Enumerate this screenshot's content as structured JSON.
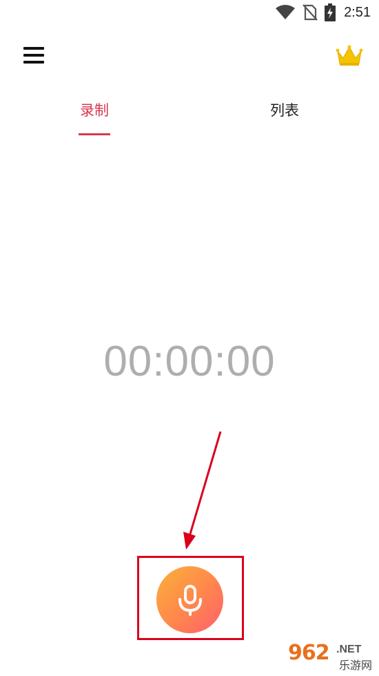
{
  "status_bar": {
    "time": "2:51"
  },
  "tabs": [
    {
      "label": "录制",
      "active": true
    },
    {
      "label": "列表",
      "active": false
    }
  ],
  "timer": {
    "value": "00:00:00"
  },
  "icons": {
    "menu": "hamburger-menu-icon",
    "premium": "crown-icon",
    "record": "microphone-icon"
  },
  "watermark": {
    "main": "962",
    "suffix": ".NET",
    "sub": "乐游网"
  },
  "colors": {
    "accent": "#d8384e",
    "timer": "#aeaeae",
    "record_start": "#fbb03b",
    "record_end": "#ff5f6d",
    "annotation": "#d9001b",
    "crown": "#f5c400"
  }
}
